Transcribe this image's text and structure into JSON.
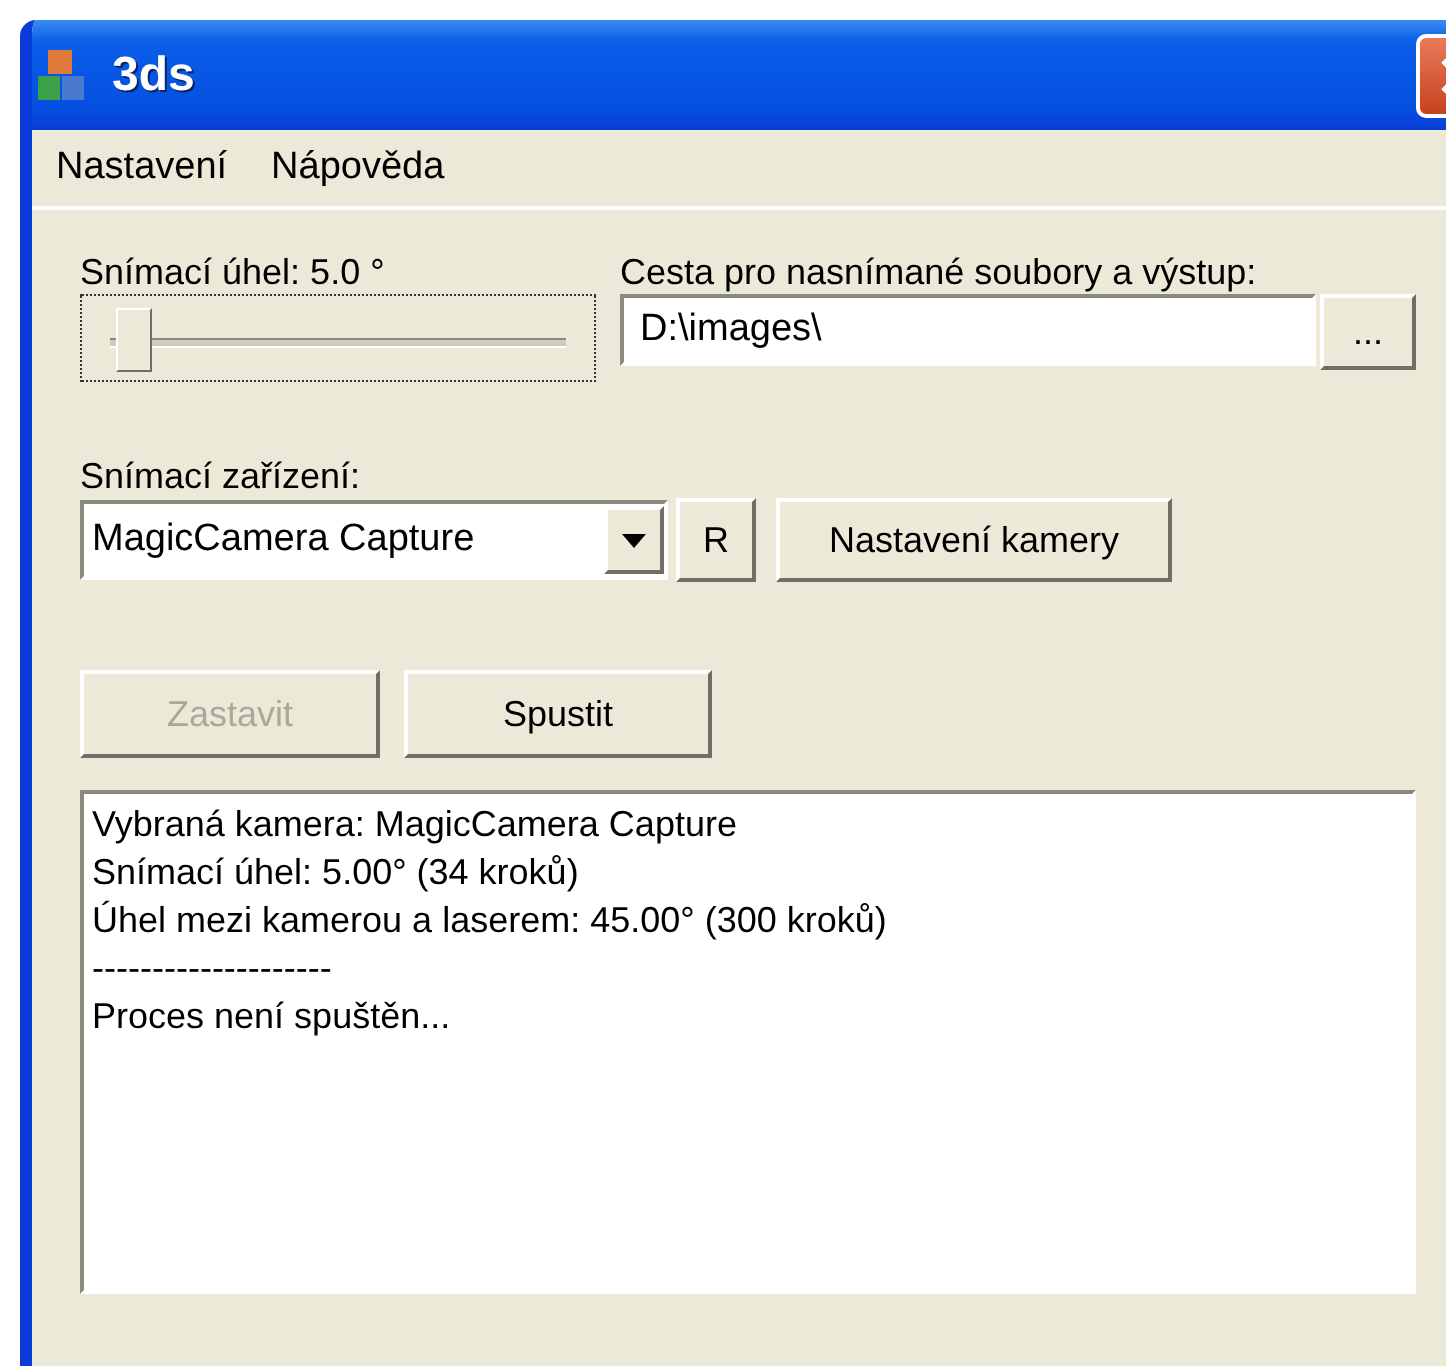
{
  "window": {
    "title": "3ds"
  },
  "menu": [
    "Nastavení",
    "Nápověda"
  ],
  "angle": {
    "label": "Snímací úhel: 5.0 °",
    "level": 0.03
  },
  "path": {
    "label": "Cesta pro nasnímané soubory a výstup:",
    "value": "D:\\images\\",
    "browse": "..."
  },
  "device": {
    "label": "Snímací zařízení:",
    "value": "MagicCamera Capture",
    "refresh": "R",
    "settings": "Nastavení kamery"
  },
  "actions": [
    {
      "label": "Zastavit",
      "disabled": true
    },
    {
      "label": "Spustit",
      "disabled": false
    }
  ],
  "log": [
    "Vybraná kamera: MagicCamera Capture",
    "Snímací úhel: 5.00° (34 kroků)",
    "Úhel mezi kamerou a laserem: 45.00° (300 kroků)",
    "--------------------",
    "Proces není spuštěn..."
  ]
}
